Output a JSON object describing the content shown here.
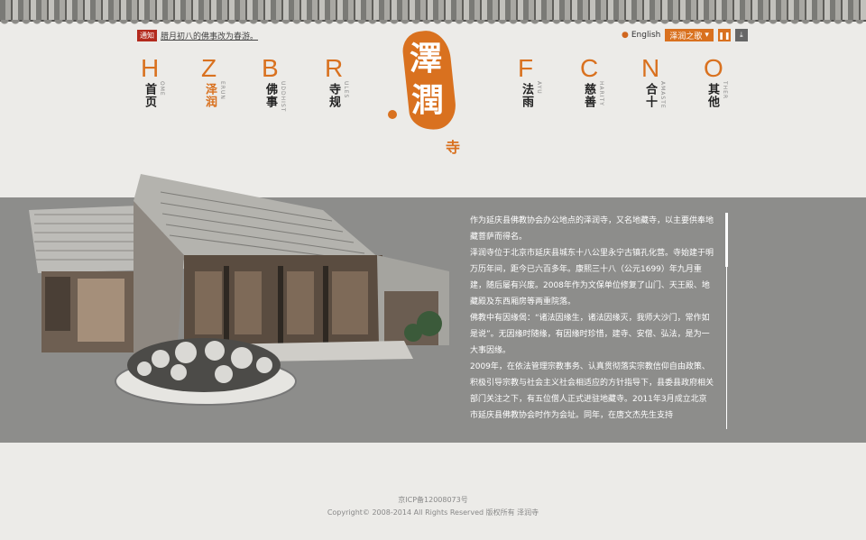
{
  "notice": {
    "badge": "通知",
    "text": "腊月初八的佛事改为春游。"
  },
  "topbar": {
    "language": "English",
    "music_label": "泽润之歌",
    "music_arrow": "▾"
  },
  "nav": [
    {
      "letter": "H",
      "label": "首页",
      "sub": "OME"
    },
    {
      "letter": "Z",
      "label": "泽润",
      "sub": "ERUN"
    },
    {
      "letter": "B",
      "label": "佛事",
      "sub": "UDDHIST"
    },
    {
      "letter": "R",
      "label": "寺规",
      "sub": "ULES"
    },
    {
      "letter": "F",
      "label": "法雨",
      "sub": "AYU"
    },
    {
      "letter": "C",
      "label": "慈善",
      "sub": "HARITY"
    },
    {
      "letter": "N",
      "label": "合十",
      "sub": "AMASTE"
    },
    {
      "letter": "O",
      "label": "其他",
      "sub": "THER"
    }
  ],
  "logo": {
    "c1": "澤",
    "c2": "潤",
    "c3": "寺"
  },
  "content": {
    "paragraphs": [
      "作为延庆县佛教协会办公地点的泽润寺，又名地藏寺，以主要供奉地藏菩萨而得名。",
      "泽润寺位于北京市延庆县城东十八公里永宁古镇孔化营。寺始建于明万历年间，距今已六百多年。康熙三十八（公元1699）年九月重建，随后屡有兴废。2008年作为文保单位修复了山门、天王殿、地藏殿及东西厢房等两重院落。",
      "佛教中有因缘偈：“诸法因缘生，诸法因缘灭，我师大沙门，常作如是说”。无因缘时随缘，有因缘时珍惜，建寺、安僧、弘法，是为一大事因缘。",
      "2009年，在依法管理宗教事务、认真贯彻落实宗教信仰自由政策、积极引导宗教与社会主义社会相适应的方针指导下，县委县政府相关部门关注之下，有五位僧人正式进驻地藏寺。2011年3月成立北京市延庆县佛教协会时作为会址。同年，在唐文杰先生支持"
    ]
  },
  "footer": {
    "icp": "京ICP备12008073号",
    "copyright": "Copyright© 2008-2014 All Rights Reserved 版权所有 泽润寺"
  },
  "colors": {
    "accent": "#d9711f",
    "band": "#8d8d8b"
  }
}
